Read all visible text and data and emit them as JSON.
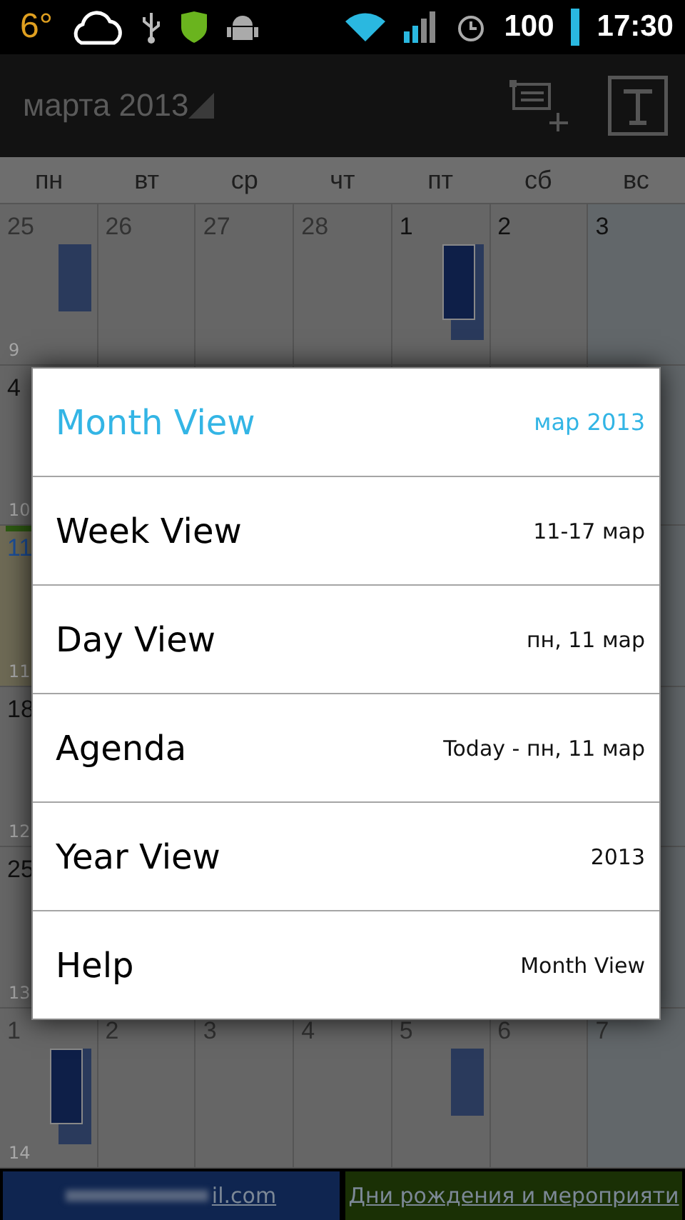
{
  "status_bar": {
    "temperature": "6°",
    "battery": "100",
    "time": "17:30"
  },
  "action_bar": {
    "title": "марта 2013"
  },
  "weekdays": [
    "пн",
    "вт",
    "ср",
    "чт",
    "пт",
    "сб",
    "вс"
  ],
  "weeks": [
    {
      "week_number": "9",
      "days": [
        {
          "label": "25",
          "in_month": false,
          "today": false,
          "kind": "single"
        },
        {
          "label": "26",
          "in_month": false,
          "today": false,
          "kind": "none"
        },
        {
          "label": "27",
          "in_month": false,
          "today": false,
          "kind": "none"
        },
        {
          "label": "28",
          "in_month": false,
          "today": false,
          "kind": "none"
        },
        {
          "label": "1",
          "in_month": true,
          "today": false,
          "kind": "double"
        },
        {
          "label": "2",
          "in_month": true,
          "today": false,
          "kind": "none"
        },
        {
          "label": "3",
          "in_month": true,
          "today": false,
          "kind": "none"
        }
      ]
    },
    {
      "week_number": "10",
      "days": [
        {
          "label": "4",
          "in_month": true,
          "today": false,
          "kind": "none"
        }
      ]
    },
    {
      "week_number": "11",
      "days": [
        {
          "label": "11",
          "in_month": true,
          "today": true,
          "kind": "none"
        }
      ]
    },
    {
      "week_number": "12",
      "days": [
        {
          "label": "18",
          "in_month": true,
          "today": false,
          "kind": "none"
        }
      ]
    },
    {
      "week_number": "13",
      "days": [
        {
          "label": "25",
          "in_month": true,
          "today": false,
          "kind": "none"
        }
      ]
    },
    {
      "week_number": "14",
      "days": [
        {
          "label": "1",
          "in_month": false,
          "today": false,
          "kind": "double"
        },
        {
          "label": "2",
          "in_month": false,
          "today": false,
          "kind": "none"
        },
        {
          "label": "3",
          "in_month": false,
          "today": false,
          "kind": "none"
        },
        {
          "label": "4",
          "in_month": false,
          "today": false,
          "kind": "none"
        },
        {
          "label": "5",
          "in_month": false,
          "today": false,
          "kind": "single"
        },
        {
          "label": "6",
          "in_month": false,
          "today": false,
          "kind": "none"
        },
        {
          "label": "7",
          "in_month": false,
          "today": false,
          "kind": "none"
        }
      ]
    }
  ],
  "view_menu": {
    "items": [
      {
        "label": "Month View",
        "detail": "мар 2013",
        "selected": true
      },
      {
        "label": "Week View",
        "detail": "11-17 мар",
        "selected": false
      },
      {
        "label": "Day View",
        "detail": "пн, 11 мар",
        "selected": false
      },
      {
        "label": "Agenda",
        "detail": "Today - пн, 11 мар",
        "selected": false
      },
      {
        "label": "Year View",
        "detail": "2013",
        "selected": false
      },
      {
        "label": "Help",
        "detail": "Month View",
        "selected": false
      }
    ]
  },
  "calendars": [
    {
      "label": "il.com",
      "color": "#0f2550",
      "blurred": true
    },
    {
      "label": "Дни рождения и мероприяти",
      "color": "#1a3005",
      "blurred": false
    }
  ]
}
